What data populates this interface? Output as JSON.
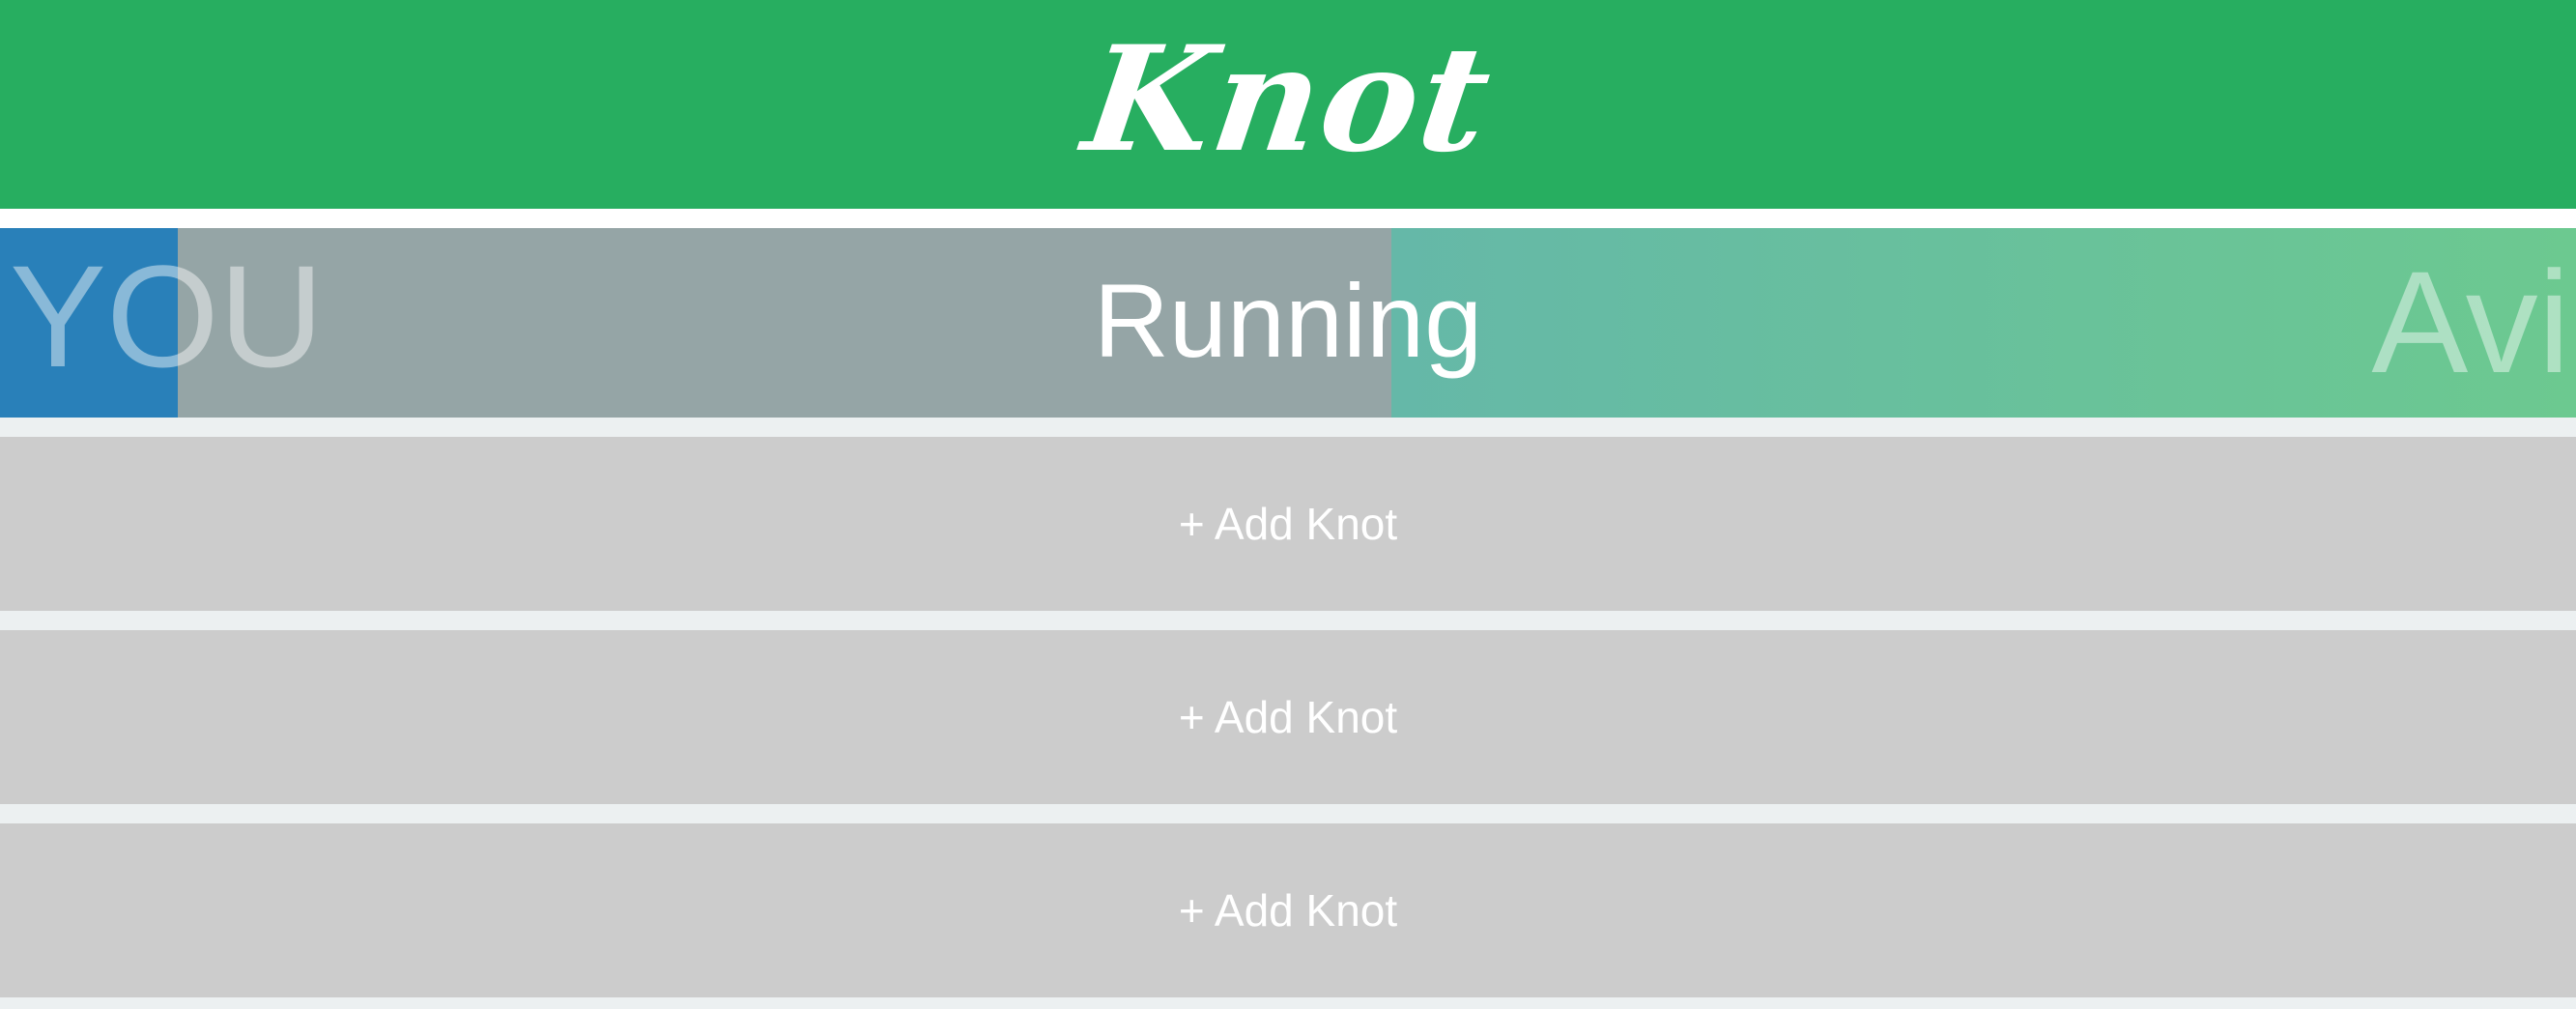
{
  "header": {
    "logo_text": "Knot",
    "color": "#27ae60"
  },
  "progress": {
    "you_label": "YOU",
    "activity_label": "Running",
    "other_label": "Avi",
    "you_fraction": 0.069,
    "other_fraction": 0.46,
    "colors": {
      "you": "#2980b9",
      "track": "#95a5a6",
      "other": "#6cc990"
    }
  },
  "slots": [
    {
      "label": "+ Add Knot"
    },
    {
      "label": "+ Add Knot"
    },
    {
      "label": "+ Add Knot"
    }
  ]
}
